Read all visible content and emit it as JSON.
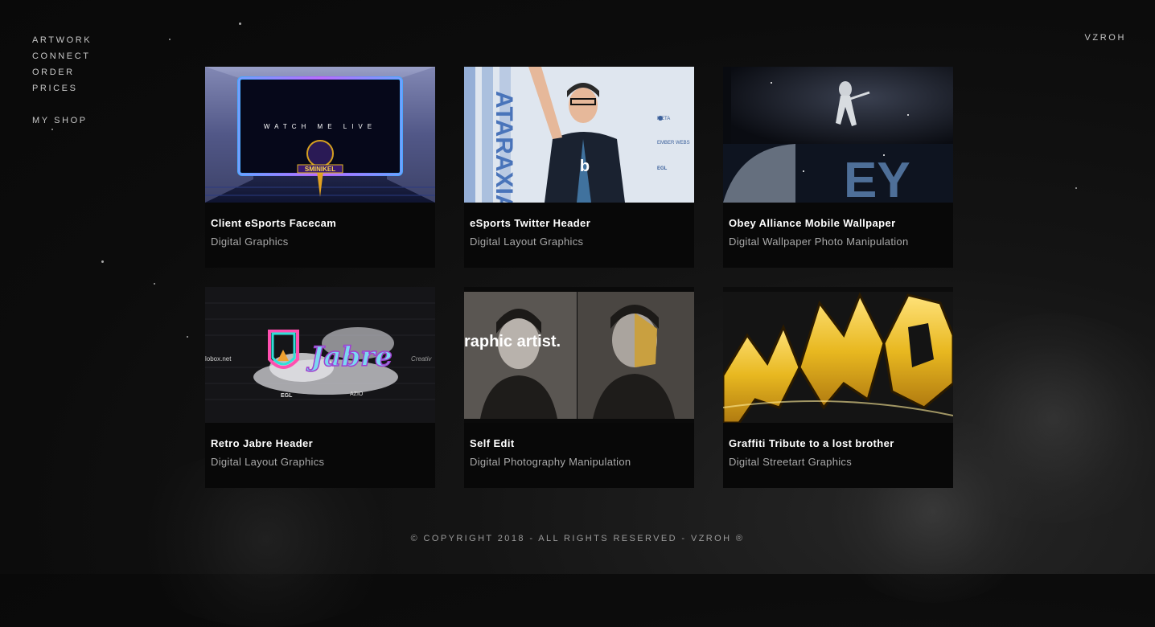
{
  "nav": {
    "artwork": "ARTWORK",
    "connect": "CONNECT",
    "order": "ORDER",
    "prices": "PRICES",
    "shop": "MY SHOP"
  },
  "brand": "VZROH",
  "cards": [
    {
      "title": "Client eSports Facecam",
      "subtitle": "Digital Graphics",
      "image_text": "WATCH ME LIVE",
      "image_logo": "SMINIKEL"
    },
    {
      "title": "eSports Twitter Header",
      "subtitle": "Digital Layout Graphics",
      "image_text": "ATARAXIA",
      "sponsors": [
        "META",
        "EMBER WEBS",
        "EGL"
      ]
    },
    {
      "title": "Obey Alliance Mobile Wallpaper",
      "subtitle": "Digital Wallpaper Photo Manipulation",
      "image_text": "EY"
    },
    {
      "title": "Retro Jabre Header",
      "subtitle": "Digital Layout Graphics",
      "image_text": "Jabre",
      "left_text": "lobox.net",
      "right_text": "Creativ",
      "sponsors": [
        "EGL",
        "AZIO"
      ]
    },
    {
      "title": "Self Edit",
      "subtitle": "Digital Photography Manipulation",
      "image_text": "raphic artist."
    },
    {
      "title": "Graffiti Tribute to a lost brother",
      "subtitle": "Digital Streetart Graphics"
    }
  ],
  "footer": "© COPYRIGHT 2018 - ALL RIGHTS RESERVED - VZROH ®",
  "colors": {
    "background": "#0c0c0c",
    "card": "#080808",
    "accent_purple": "#a05cff",
    "accent_gold": "#e8b820"
  }
}
